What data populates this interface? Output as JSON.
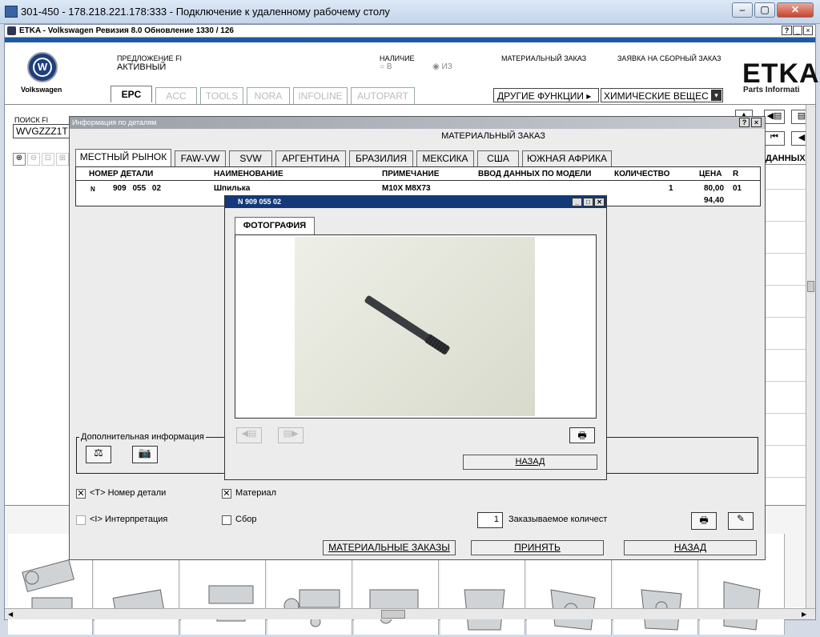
{
  "rdp_title": "301-450 - 178.218.221.178:333 - Подключение к удаленному рабочему столу",
  "win_buttons": {
    "min": "–",
    "max": "▢",
    "close": "✕"
  },
  "app_title": "ETKA - Volkswagen Ревизия 8.0 Обновление 1330 / 126",
  "app_title_buttons": [
    "?",
    "_",
    "×"
  ],
  "brand": "Volkswagen",
  "offer_label": "ПРЕДЛОЖЕНИЕ FI",
  "offer_value": "АКТИВНЫЙ",
  "avail_label": "НАЛИЧИЕ",
  "avail_opts": [
    "В",
    "ИЗ"
  ],
  "material_order_label": "МАТЕРИАЛЬНЫЙ ЗАКАЗ",
  "assembly_order_label": "ЗАЯВКА НА СБОРНЫЙ ЗАКАЗ",
  "etka_logo": "ETKA",
  "etka_sub": "Parts Informati",
  "main_tabs": [
    "EPC",
    "ACC",
    "TOOLS",
    "NORA",
    "INFOLINE",
    "AUTOPART"
  ],
  "other_functions": "ДРУГИЕ ФУНКЦИИ",
  "chem_select": "ХИМИЧЕСКИЕ ВЕЩЕС",
  "search_label": "ПОИСК FI",
  "search_value": "WVGZZZ1T",
  "right_partial": "ДАННЫХ П",
  "dialog": {
    "title": "Информация по деталям",
    "title_buttons": [
      "?",
      "×"
    ],
    "heading": "МАТЕРИАЛЬНЫЙ ЗАКАЗ",
    "region_tabs": [
      "МЕСТНЫЙ РЫНОК",
      "FAW-VW",
      "SVW",
      "АРГЕНТИНА",
      "БРАЗИЛИЯ",
      "МЕКСИКА",
      "США",
      "ЮЖНАЯ АФРИКА"
    ],
    "columns": [
      "НОМЕР ДЕТАЛИ",
      "НАИМЕНОВАНИЕ",
      "ПРИМЕЧАНИЕ",
      "ВВОД ДАННЫХ ПО МОДЕЛИ",
      "КОЛИЧЕСТВО",
      "ЦЕНА",
      "R"
    ],
    "row": {
      "flag": "N",
      "part": "909 055 02",
      "name": "Шпилька",
      "note": "M10X M8X73",
      "qty": "1",
      "price": "80,00",
      "price2": "94,40",
      "r": "01"
    },
    "additional_info": "Дополнительная информация",
    "chk_part": "<T> Номер детали",
    "chk_material": "Материал",
    "chk_interp": "<I> Интерпретация",
    "chk_assembly": "Сбор",
    "qty_value": "1",
    "qty_label": "Заказываемое количест",
    "btn_material_orders": "МАТЕРИАЛЬНЫЕ ЗАКАЗЫ",
    "btn_accept": "ПРИНЯТЬ",
    "btn_back": "НАЗАД"
  },
  "photo": {
    "title": "N  909 055 02",
    "tab": "ФОТОГРАФИЯ",
    "btn_back": "НАЗАД"
  },
  "colors": {
    "accent": "#13397a",
    "brand_blue": "#1f5aa0"
  }
}
